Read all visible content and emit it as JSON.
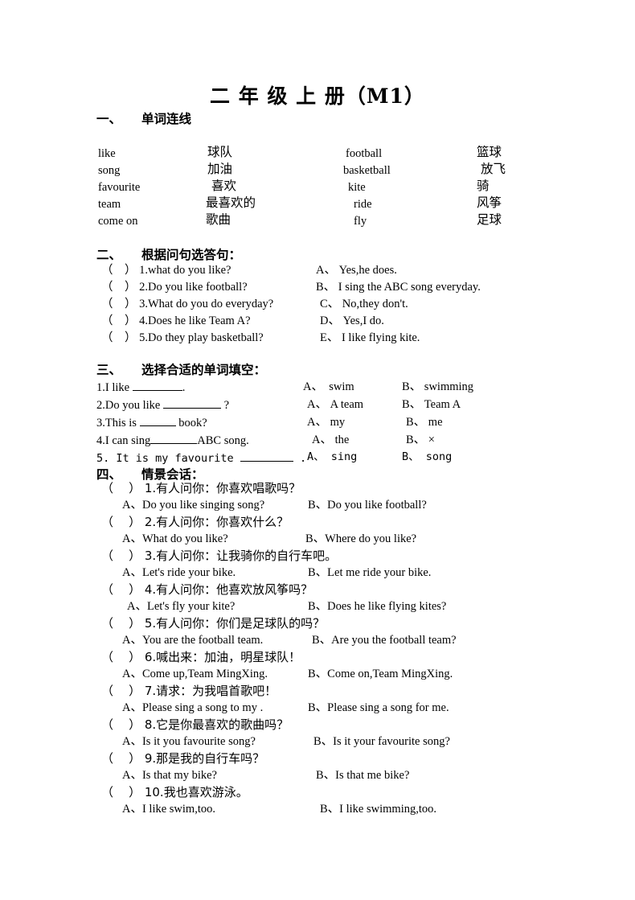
{
  "document": {
    "title": "二 年 级 上 册（M1）"
  },
  "section1": {
    "number": "一、",
    "title": "单词连线",
    "left_pairs": [
      {
        "en": "like",
        "cn": "球队"
      },
      {
        "en": "song",
        "cn": "加油"
      },
      {
        "en": "favourite",
        "cn": "喜欢"
      },
      {
        "en": "team",
        "cn": "最喜欢的"
      },
      {
        "en": "come on",
        "cn": "歌曲"
      }
    ],
    "right_pairs": [
      {
        "en": "football",
        "cn": "篮球"
      },
      {
        "en": "basketball",
        "cn": "放飞"
      },
      {
        "en": "kite",
        "cn": "骑"
      },
      {
        "en": "ride",
        "cn": "风筝"
      },
      {
        "en": "fly",
        "cn": "足球"
      }
    ]
  },
  "section2": {
    "number": "二、",
    "title": "根据问句选答句：",
    "questions": [
      "（    ） 1.what do you like?",
      "（    ） 2.Do you like football?",
      "（    ） 3.What do you do everyday?",
      "（    ） 4.Does he like Team A?",
      "（    ） 5.Do they play basketball?"
    ],
    "answers": [
      "A、 Yes,he does.",
      "B、 I sing the ABC song everyday.",
      "C、 No,they don't.",
      "D、 Yes,I do.",
      "E、 I like flying kite."
    ]
  },
  "section3": {
    "number": "三、",
    "title": "选择合适的单词填空：",
    "items": [
      {
        "prefix": "1.I like ",
        "blank1": 62,
        "suffix": "."
      },
      {
        "prefix": "2.Do you like ",
        "blank1": 72,
        "suffix": " ?"
      },
      {
        "prefix": "3.This is ",
        "blank1": 45,
        "suffix": " book?"
      },
      {
        "prefix": "4.I can sing",
        "blank1": 58,
        "suffix": "ABC song."
      },
      {
        "prefix": "5. It is my favourite ",
        "blank1": 66,
        "suffix": " ."
      }
    ],
    "options_a": [
      "A、  swim",
      "A、 A team",
      "A、 my",
      "A、 the",
      "A、 sing"
    ],
    "options_b": [
      "B、 swimming",
      "B、 Team A",
      "B、 me",
      "B、 ×",
      "B、 song"
    ]
  },
  "section4": {
    "number": "四、",
    "title": "情景会话：",
    "items": [
      {
        "prompt": "（    ） 1.有人问你：你喜欢唱歌吗？",
        "a": "A、Do you like singing song?",
        "b": "B、Do you like football?"
      },
      {
        "prompt": "（    ） 2.有人问你：你喜欢什么？",
        "a": "A、What do you like?",
        "b": "B、Where do you like?"
      },
      {
        "prompt": "（    ） 3.有人问你：让我骑你的自行车吧。",
        "a": "A、Let's ride your bike.",
        "b": "B、Let me ride your bike."
      },
      {
        "prompt": "（    ） 4.有人问你：他喜欢放风筝吗？",
        "a": "A、Let's fly your kite?",
        "b": "B、Does he like flying kites?"
      },
      {
        "prompt": "（    ） 5.有人问你：你们是足球队的吗？",
        "a": "A、You are the football team.",
        "b": "B、Are you the football team?"
      },
      {
        "prompt": "（    ） 6.喊出来：加油，明星球队！",
        "a": "A、Come up,Team MingXing.",
        "b": "B、Come on,Team MingXing."
      },
      {
        "prompt": "（    ） 7.请求：为我唱首歌吧！",
        "a": "A、Please sing a song to my .",
        "b": "B、Please sing a song for me."
      },
      {
        "prompt": "（    ） 8.它是你最喜欢的歌曲吗？",
        "a": "A、Is it you favourite song?",
        "b": "B、Is it your favourite song?"
      },
      {
        "prompt": "（    ） 9.那是我的自行车吗？",
        "a": "A、Is that my bike?",
        "b": "B、Is that me bike?"
      },
      {
        "prompt": "（    ） 10.我也喜欢游泳。",
        "a": "A、I like swim,too.",
        "b": "B、I like swimming,too."
      }
    ]
  }
}
